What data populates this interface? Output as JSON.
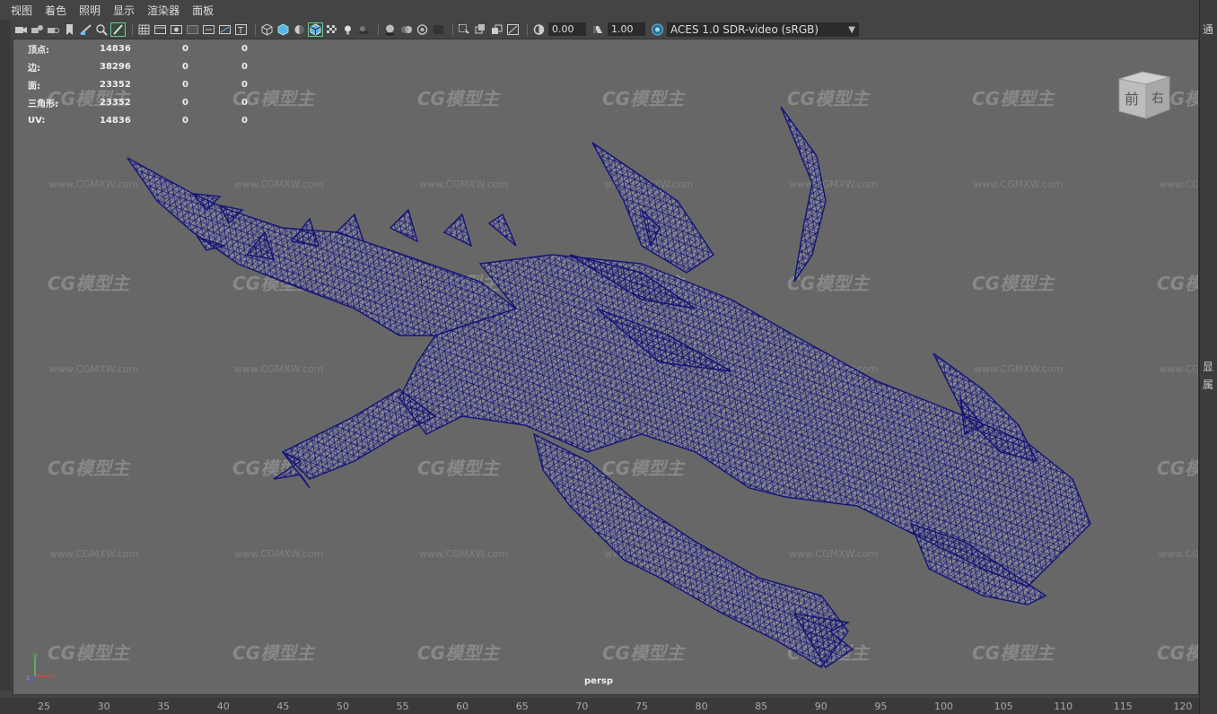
{
  "menu": [
    "视图",
    "着色",
    "照明",
    "显示",
    "渲染器",
    "面板"
  ],
  "toolbar": {
    "exposure_value": "0.00",
    "gamma_value": "1.00",
    "color_management": "ACES 1.0 SDR-video (sRGB)"
  },
  "hud": {
    "rows": [
      {
        "label": "顶点:",
        "v1": "14836",
        "v2": "0",
        "v3": "0"
      },
      {
        "label": "边:",
        "v1": "38296",
        "v2": "0",
        "v3": "0"
      },
      {
        "label": "面:",
        "v1": "23352",
        "v2": "0",
        "v3": "0"
      },
      {
        "label": "三角形:",
        "v1": "23352",
        "v2": "0",
        "v3": "0"
      },
      {
        "label": "UV:",
        "v1": "14836",
        "v2": "0",
        "v3": "0"
      }
    ]
  },
  "viewcube": {
    "face_front": "前",
    "face_right": "右"
  },
  "camera_label": "persp",
  "axis": {
    "x": "x",
    "y": "y",
    "z": "z"
  },
  "watermark": {
    "logo": "CG模型主",
    "url": "www.CGMXW.com"
  },
  "timeline_ticks": [
    "25",
    "30",
    "35",
    "40",
    "45",
    "50",
    "55",
    "60",
    "65",
    "70",
    "75",
    "80",
    "85",
    "90",
    "95",
    "100",
    "105",
    "110",
    "115",
    "120"
  ],
  "right_panel_glyphs": [
    "通",
    "显",
    "属"
  ],
  "colors": {
    "wireframe": "#141478",
    "mesh_fill": "#8a8a8a",
    "viewport_bg": "#676767"
  }
}
